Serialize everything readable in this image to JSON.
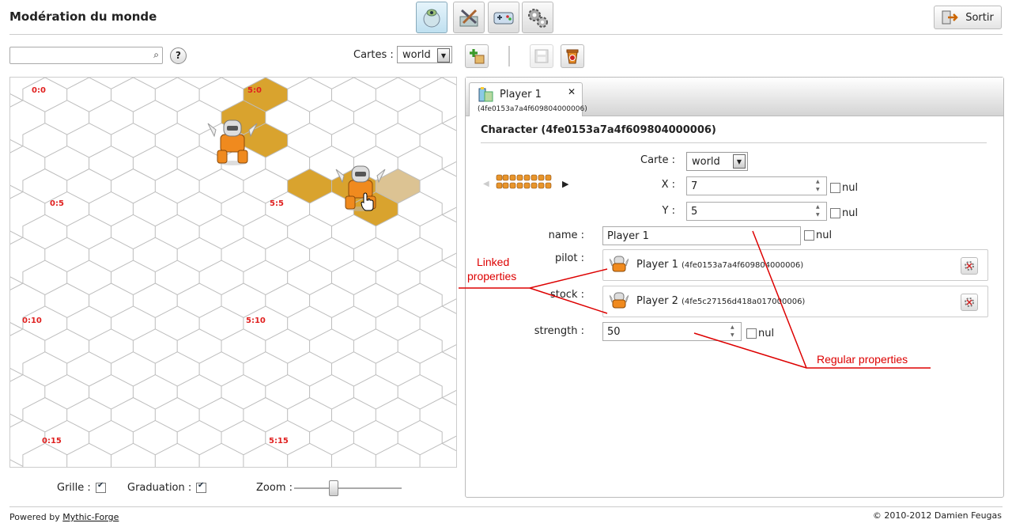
{
  "header": {
    "title": "Modération du monde",
    "logout_label": "Sortir",
    "nav_icons": [
      "moderation-icon",
      "builder-icon",
      "game-icon",
      "settings-icon"
    ]
  },
  "toolbar": {
    "search_value": "",
    "help_label": "?",
    "maps_label": "Cartes :",
    "maps_selected": "world"
  },
  "map": {
    "coords": [
      "0:0",
      "5:0",
      "0:5",
      "5:5",
      "0:10",
      "5:10",
      "0:15",
      "5:15"
    ]
  },
  "map_controls": {
    "grid_label": "Grille :",
    "grid_checked": true,
    "graduation_label": "Graduation :",
    "graduation_checked": true,
    "zoom_label": "Zoom :",
    "zoom_level": 0.35
  },
  "tab": {
    "title": "Player 1",
    "subtitle": "(4fe0153a7a4f609804000006)"
  },
  "details": {
    "heading": "Character (4fe0153a7a4f609804000006)",
    "map_label": "Carte :",
    "map_value": "world",
    "x_label": "X :",
    "x_value": "7",
    "y_label": "Y :",
    "y_value": "5",
    "name_label": "name :",
    "name_value": "Player 1",
    "pilot_label": "pilot :",
    "pilot_name": "Player 1",
    "pilot_id": "(4fe0153a7a4f609804000006)",
    "stock_label": "stock :",
    "stock_name": "Player 2",
    "stock_id": "(4fe5c27156d418a017000006)",
    "strength_label": "strength :",
    "strength_value": "50",
    "nul_label": "nul"
  },
  "annotations": {
    "linked_line1": "Linked",
    "linked_line2": "properties",
    "regular": "Regular properties"
  },
  "footer": {
    "powered_prefix": "Powered by",
    "powered_link": "Mythic-Forge",
    "copyright": "© 2010-2012 Damien Feugas"
  },
  "colors": {
    "highlight_hex": "#d9a32e",
    "coord_text": "#e0201f",
    "annotation_red": "#d00000"
  }
}
